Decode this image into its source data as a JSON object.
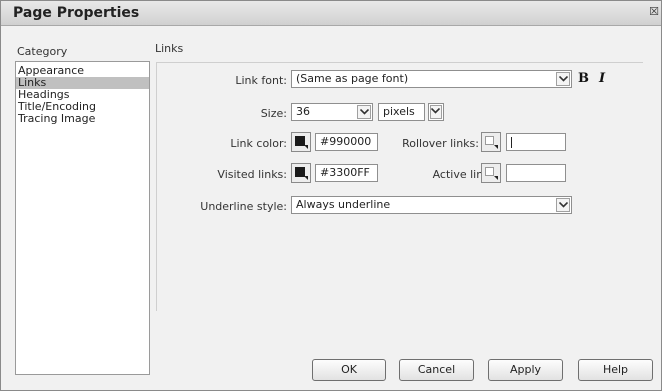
{
  "dialog": {
    "title": "Page Properties"
  },
  "sidebar": {
    "header": "Category",
    "items": [
      {
        "label": "Appearance",
        "selected": false
      },
      {
        "label": "Links",
        "selected": true
      },
      {
        "label": "Headings",
        "selected": false
      },
      {
        "label": "Title/Encoding",
        "selected": false
      },
      {
        "label": "Tracing Image",
        "selected": false
      }
    ]
  },
  "section": {
    "title": "Links"
  },
  "link_font": {
    "label": "Link font:",
    "value": "(Same as page font)",
    "bold_label": "B",
    "italic_label": "I"
  },
  "size": {
    "label": "Size:",
    "value": "36",
    "unit": "pixels"
  },
  "link_color": {
    "label": "Link color:",
    "swatch": "#1a1a1a",
    "value": "#990000"
  },
  "rollover_links": {
    "label": "Rollover links:",
    "value": ""
  },
  "visited_links": {
    "label": "Visited links:",
    "swatch": "#1a1a1a",
    "value": "#3300FF"
  },
  "active_links": {
    "label": "Active links:",
    "value": ""
  },
  "underline_style": {
    "label": "Underline style:",
    "value": "Always underline"
  },
  "buttons": {
    "ok": "OK",
    "cancel": "Cancel",
    "apply": "Apply",
    "help": "Help"
  }
}
